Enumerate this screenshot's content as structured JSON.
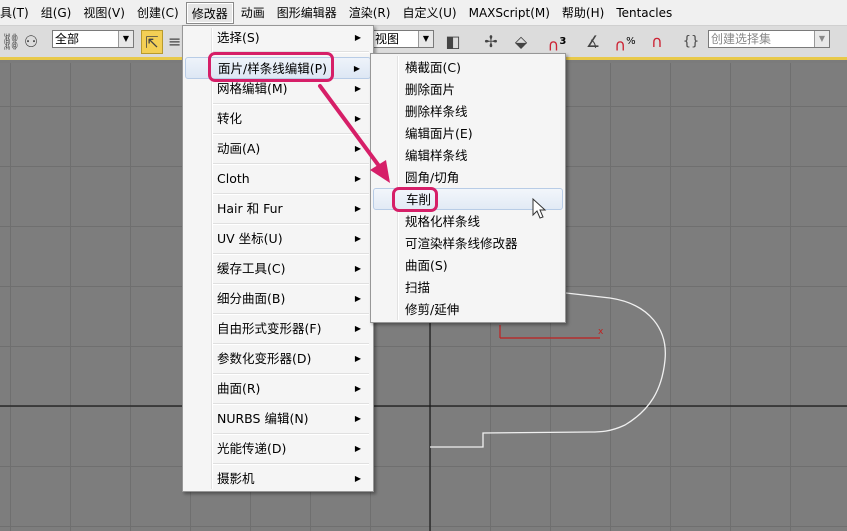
{
  "menubar": [
    "具(T)",
    "组(G)",
    "视图(V)",
    "创建(C)",
    "修改器",
    "动画",
    "图形编辑器",
    "渲染(R)",
    "自定义(U)",
    "MAXScript(M)",
    "帮助(H)",
    "Tentacles"
  ],
  "toolbar": {
    "filter_value": "全部",
    "view_value": "视图",
    "selection_set_placeholder": "创建选择集",
    "snap_label": "3"
  },
  "main_menu": [
    {
      "label": "选择(S)"
    },
    {
      "label": "面片/样条线编辑(P)",
      "highlighted": true
    },
    {
      "label": "网格编辑(M)"
    },
    {
      "label": "转化"
    },
    {
      "label": "动画(A)"
    },
    {
      "label": "Cloth"
    },
    {
      "label": "Hair 和 Fur"
    },
    {
      "label": "UV 坐标(U)"
    },
    {
      "label": "缓存工具(C)"
    },
    {
      "label": "细分曲面(B)"
    },
    {
      "label": "自由形式变形器(F)"
    },
    {
      "label": "参数化变形器(D)"
    },
    {
      "label": "曲面(R)"
    },
    {
      "label": "NURBS 编辑(N)"
    },
    {
      "label": "光能传递(D)"
    },
    {
      "label": "摄影机"
    }
  ],
  "submenu": [
    {
      "label": "横截面(C)"
    },
    {
      "label": "删除面片"
    },
    {
      "label": "删除样条线"
    },
    {
      "label": "编辑面片(E)"
    },
    {
      "label": "编辑样条线"
    },
    {
      "label": "圆角/切角"
    },
    {
      "label": "车削",
      "highlighted": true
    },
    {
      "label": "规格化样条线"
    },
    {
      "label": "可渲染样条线修改器"
    },
    {
      "label": "曲面(S)"
    },
    {
      "label": "扫描"
    },
    {
      "label": "修剪/延伸"
    }
  ],
  "colors": {
    "annotation": "#d61f68",
    "toolbar_accent": "#e8c94a",
    "viewport": "#7d7d7d"
  }
}
